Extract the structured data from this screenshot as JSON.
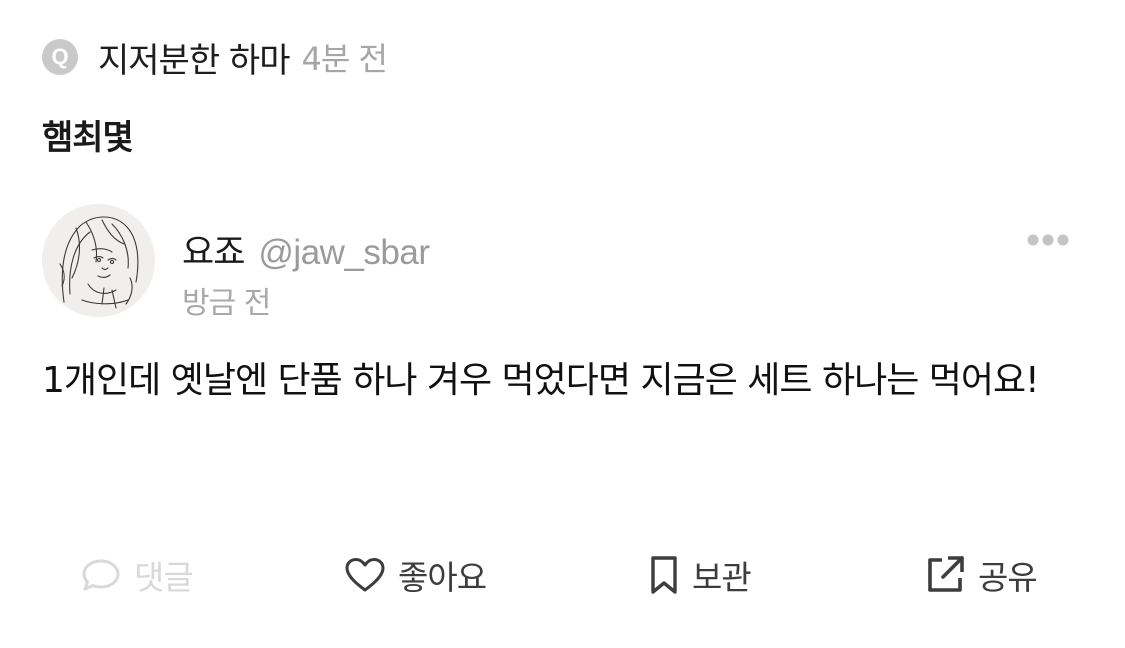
{
  "question": {
    "badge": "Q",
    "author": "지저분한 하마",
    "time": "4분 전",
    "title": "햄최몇"
  },
  "answer": {
    "name": "요죠",
    "handle": "@jaw_sbar",
    "time": "방금 전",
    "body": "1개인데 옛날엔 단품 하나 겨우 먹었다면 지금은 세트 하나는 먹어요!",
    "more_icon": "more-dots-icon",
    "avatar_icon": "sketch-portrait"
  },
  "actions": {
    "comment": {
      "label": "댓글",
      "icon": "speech-bubble-icon",
      "enabled": false
    },
    "like": {
      "label": "좋아요",
      "icon": "heart-icon",
      "enabled": true
    },
    "save": {
      "label": "보관",
      "icon": "bookmark-icon",
      "enabled": true
    },
    "share": {
      "label": "공유",
      "icon": "share-external-icon",
      "enabled": true
    }
  },
  "colors": {
    "text_primary": "#1a1a1a",
    "text_secondary": "#a6a6a6",
    "badge_bg": "#c9c9c9",
    "action_enabled": "#3d3d3d",
    "action_disabled": "#d9d9d9"
  }
}
